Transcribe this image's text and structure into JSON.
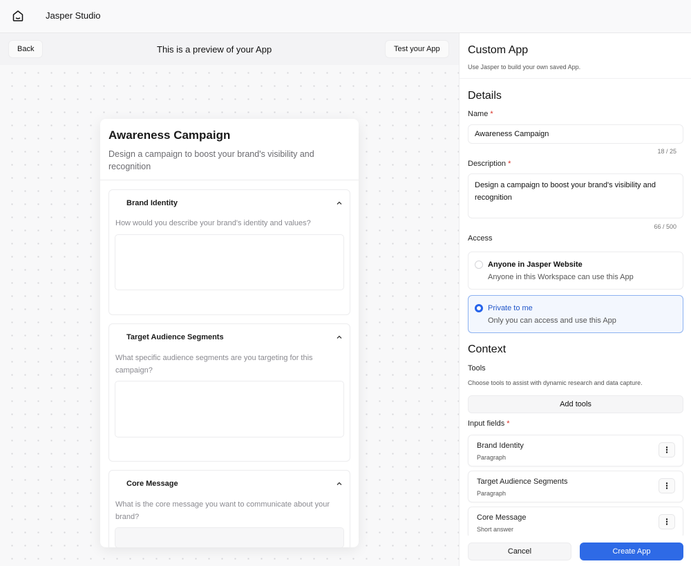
{
  "app": {
    "title": "Jasper Studio",
    "home_icon": "home-icon"
  },
  "preview": {
    "back_label": "Back",
    "banner": "This is a preview of your App",
    "test_label": "Test your App",
    "card": {
      "title": "Awareness Campaign",
      "description": "Design a campaign to boost your brand's visibility and recognition",
      "sections": [
        {
          "label": "Brand Identity",
          "question": "How would you describe your brand's identity and values?",
          "icon": "chevron-up-icon"
        },
        {
          "label": "Target Audience Segments",
          "question": "What specific audience segments are you targeting for this campaign?",
          "icon": "chevron-up-icon"
        },
        {
          "label": "Core Message",
          "question": "What is the core message you want to communicate about your brand?",
          "icon": "chevron-up-icon"
        }
      ]
    }
  },
  "panel": {
    "title": "Custom App",
    "subtitle": "Use Jasper to build your own saved App.",
    "details_heading": "Details",
    "name_label": "Name",
    "required_mark": "*",
    "name_value": "Awareness Campaign",
    "name_counter": "18 / 25",
    "description_label": "Description",
    "description_value": "Design a campaign to boost your brand's visibility and recognition",
    "description_counter": "66 / 500",
    "access_label": "Access",
    "access_options": [
      {
        "title": "Anyone in Jasper Website",
        "subtitle": "Anyone in this Workspace can use this App",
        "selected": false
      },
      {
        "title": "Private to me",
        "subtitle": "Only you can access and use this App",
        "selected": true
      }
    ],
    "context_heading": "Context",
    "tools_label": "Tools",
    "tools_subtitle": "Choose tools to assist with dynamic research and data capture.",
    "add_tools_label": "Add tools",
    "input_fields_label": "Input fields",
    "input_fields": [
      {
        "name": "Brand Identity",
        "type": "Paragraph"
      },
      {
        "name": "Target Audience Segments",
        "type": "Paragraph"
      },
      {
        "name": "Core Message",
        "type": "Short answer"
      }
    ],
    "kebab_glyph": "⋮",
    "cancel_label": "Cancel",
    "create_label": "Create App"
  },
  "colors": {
    "accent": "#2e6ae6",
    "selected_bg": "#f3f7fe",
    "required": "#d93025"
  }
}
